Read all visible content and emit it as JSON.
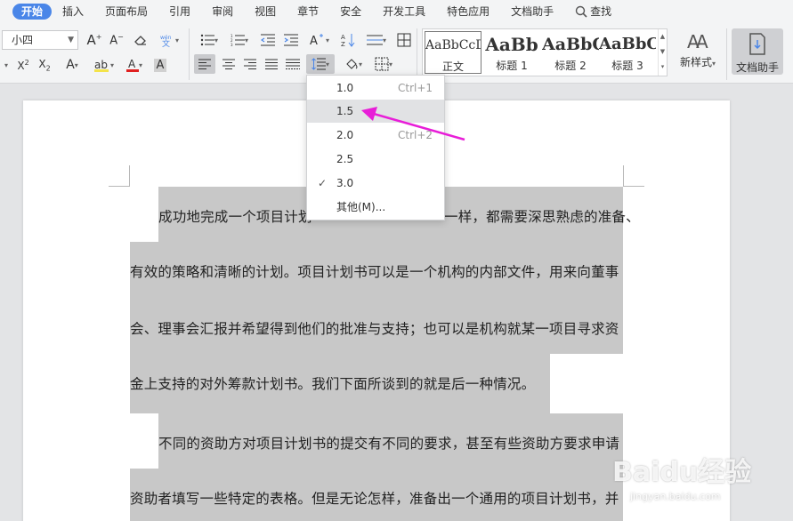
{
  "menu": {
    "items": [
      "开始",
      "插入",
      "页面布局",
      "引用",
      "审阅",
      "视图",
      "章节",
      "安全",
      "开发工具",
      "特色应用",
      "文档助手"
    ],
    "search_label": "查找"
  },
  "ribbon": {
    "font_size": "小四",
    "styles": [
      {
        "preview": "AaBbCcDd",
        "label": "正文"
      },
      {
        "preview": "AaBb",
        "label": "标题 1"
      },
      {
        "preview": "AaBbC",
        "label": "标题 2"
      },
      {
        "preview": "AaBbC",
        "label": "标题 3"
      }
    ],
    "new_style_label": "新样式",
    "doc_assistant_label": "文档助手"
  },
  "line_spacing_menu": {
    "items": [
      {
        "value": "1.0",
        "shortcut": "Ctrl+1"
      },
      {
        "value": "1.5",
        "shortcut": ""
      },
      {
        "value": "2.0",
        "shortcut": "Ctrl+2"
      },
      {
        "value": "2.5",
        "shortcut": ""
      },
      {
        "value": "3.0",
        "shortcut": ""
      },
      {
        "value": "其他(M)...",
        "shortcut": ""
      }
    ],
    "checked_value": "3.0",
    "hovered_value": "1.5"
  },
  "document": {
    "lines": [
      "成功地完成一个项目计划",
      "一样，都需要深思熟虑的准备、",
      "有效的策略和清晰的计划。项目计划书可以是一个机构的内部文件，用来向董事",
      "会、理事会汇报并希望得到他们的批准与支持；也可以是机构就某一项目寻求资",
      "金上支持的对外筹款计划书。我们下面所谈到的就是后一种情况。",
      "不同的资助方对项目计划书的提交有不同的要求，甚至有些资助方要求申请",
      "资助者填写一些特定的表格。但是无论怎样，准备出一个通用的项目计划书，并"
    ]
  },
  "watermark": {
    "main": "Baidu经验",
    "sub": "jingyan.baidu.com"
  },
  "colors": {
    "accent": "#4a86e8",
    "arrow": "#e81ed8",
    "selection": "#c8c8c8"
  }
}
